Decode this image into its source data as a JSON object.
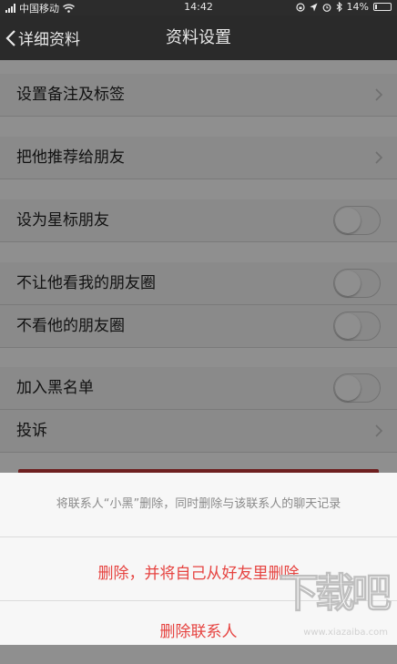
{
  "status_bar": {
    "carrier": "中国移动",
    "time": "14:42",
    "battery": "14%",
    "battery_level": 0.14
  },
  "nav": {
    "back_label": "详细资料",
    "title": "资料设置"
  },
  "settings": {
    "remark_label": "设置备注及标签",
    "recommend_label": "把他推荐给朋友",
    "star_label": "设为星标朋友",
    "star_on": false,
    "hide_moments_label": "不让他看我的朋友圈",
    "hide_moments_on": false,
    "ignore_moments_label": "不看他的朋友圈",
    "ignore_moments_on": false,
    "blacklist_label": "加入黑名单",
    "blacklist_on": false,
    "report_label": "投诉"
  },
  "action_sheet": {
    "message": "将联系人“小黑”删除，同时删除与该联系人的聊天记录",
    "delete_both_label": "删除，并将自己从好友里删除",
    "delete_label": "删除联系人",
    "destructive_color": "#e64340"
  },
  "watermark": {
    "text": "下载吧",
    "url": "www.xiazaiba.com"
  }
}
